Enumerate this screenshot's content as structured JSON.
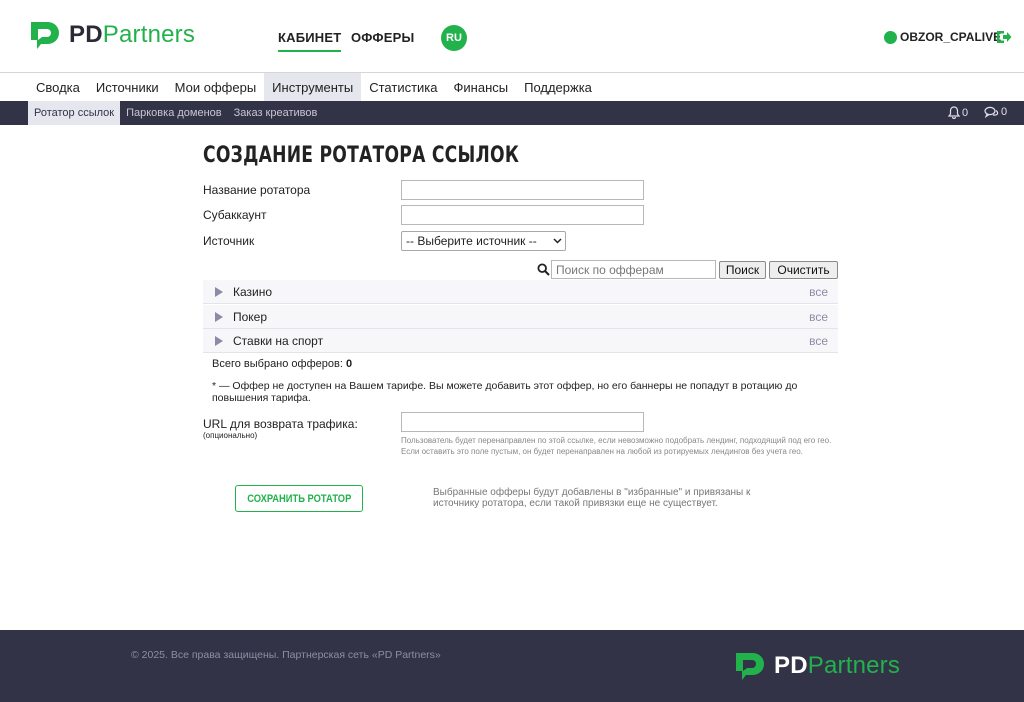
{
  "brand": {
    "pd": "PD",
    "partners": "Partners",
    "accent": "#22b24c"
  },
  "header": {
    "nav_cabinet": "КАБИНЕТ",
    "nav_offers": "ОФФЕРЫ",
    "lang": "RU",
    "username": "OBZOR_CPALIVE",
    "logout_icon": "logout-icon"
  },
  "main_nav": [
    {
      "label": "Сводка",
      "active": false
    },
    {
      "label": "Источники",
      "active": false
    },
    {
      "label": "Мои офферы",
      "active": false
    },
    {
      "label": "Инструменты",
      "active": true
    },
    {
      "label": "Статистика",
      "active": false
    },
    {
      "label": "Финансы",
      "active": false
    },
    {
      "label": "Поддержка",
      "active": false
    }
  ],
  "sub_nav": [
    {
      "label": "Ротатор ссылок",
      "active": true
    },
    {
      "label": "Парковка доменов",
      "active": false
    },
    {
      "label": "Заказ креативов",
      "active": false
    }
  ],
  "notifications": {
    "bell_count": "0",
    "messages_count": "0"
  },
  "form": {
    "title": "Создание ротатора ссылок",
    "name_label": "Название ротатора",
    "name_value": "",
    "subaccount_label": "Субаккаунт",
    "subaccount_value": "",
    "source_label": "Источник",
    "source_selected": "-- Выберите источник --",
    "search_placeholder": "Поиск по офферам",
    "search_button": "Поиск",
    "clear_button": "Очистить",
    "categories": [
      {
        "name": "Казино",
        "all": "все"
      },
      {
        "name": "Покер",
        "all": "все"
      },
      {
        "name": "Ставки на спорт",
        "all": "все"
      }
    ],
    "total_label": "Всего выбрано офферов:",
    "total_count": "0",
    "tariff_note": "* — Оффер не доступен на Вашем тарифе. Вы можете добавить этот оффер, но его баннеры не попадут в ротацию до повышения тарифа.",
    "url_label": "URL для возврата трафика:",
    "url_sub": "(опционально)",
    "url_value": "",
    "url_help": "Пользователь будет перенаправлен по этой ссылке, если невозможно подобрать лендинг, подходящий под его гео. Если оставить это поле пустым, он будет перенаправлен на любой из ротируемых лендингов без учета гео.",
    "save_button": "Сохранить ротатор",
    "save_note": "Выбранные офферы будут добавлены в \"избранные\" и привязаны к источнику ротатора, если такой привязки еще не существует."
  },
  "footer": {
    "copyright": "© 2025. Все права защищены. Партнерская сеть «PD Partners»"
  }
}
